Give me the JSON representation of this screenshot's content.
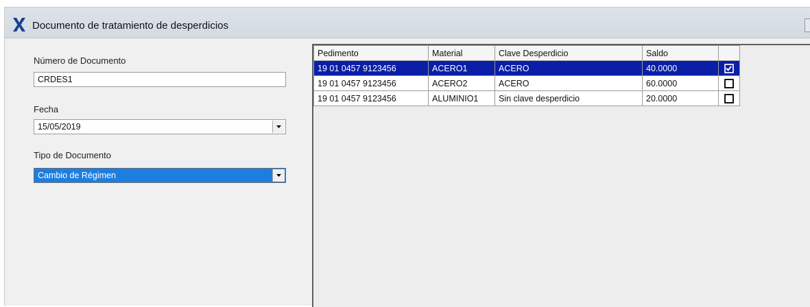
{
  "window": {
    "title": "Documento de tratamiento de desperdicios"
  },
  "form": {
    "numero_label": "Número de Documento",
    "numero_value": "CRDES1",
    "fecha_label": "Fecha",
    "fecha_value": "15/05/2019",
    "tipo_label": "Tipo de Documento",
    "tipo_value": "Cambio de Régimen"
  },
  "grid": {
    "columns": [
      "Pedimento",
      "Material",
      "Clave Desperdicio",
      "Saldo",
      ""
    ],
    "rows": [
      {
        "pedimento": "19 01 0457 9123456",
        "material": "ACERO1",
        "clave": "ACERO",
        "saldo": "40.0000",
        "checked": true,
        "selected": true
      },
      {
        "pedimento": "19 01 0457 9123456",
        "material": "ACERO2",
        "clave": "ACERO",
        "saldo": "60.0000",
        "checked": false,
        "selected": false
      },
      {
        "pedimento": "19 01 0457 9123456",
        "material": "ALUMINIO1",
        "clave": "Sin clave desperdicio",
        "saldo": "20.0000",
        "checked": false,
        "selected": false
      }
    ]
  },
  "icons": {
    "app": "x-logo-icon",
    "dropdown": "chevron-down-icon",
    "checkbox": "checkbox-icon"
  },
  "colors": {
    "selection_row": "#0a1ea8",
    "combo_selected": "#1e7ee0",
    "app_icon": "#1b3f8f"
  }
}
